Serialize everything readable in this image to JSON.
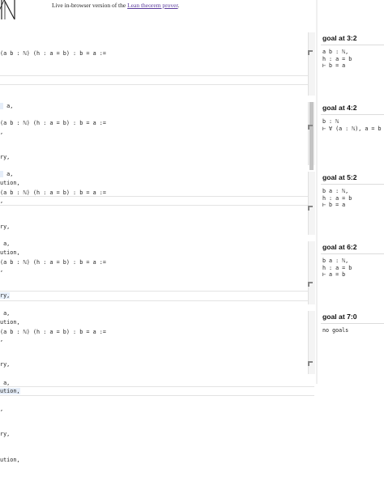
{
  "header": {
    "tagline_prefix": "Live in-browser version of the ",
    "tagline_link": "Lean theorem prover",
    "tagline_suffix": "."
  },
  "blocks": [
    {
      "lines": [
        "(a b : ℕ) (h : a = b) : b = a :=",
        "",
        " a,",
        ",",
        "ry,",
        "ution,"
      ],
      "goal": {
        "title": "goal at 3:2",
        "body": [
          "a b : ℕ,",
          "h : a = b",
          "⊢ b = a"
        ]
      }
    },
    {
      "lines": [
        "(a b : ℕ) (h : a = b) : b = a :=",
        "",
        " a,",
        ",",
        "ry,",
        "ution,"
      ],
      "goal": {
        "title": "goal at 4:2",
        "body": [
          "b : ℕ",
          "⊢ ∀ (a : ℕ), a = b"
        ]
      }
    },
    {
      "lines": [
        "(a b : ℕ) (h : a = b) : b = a :=",
        "",
        " a,",
        ",",
        "ry,",
        "ution,"
      ],
      "goal": {
        "title": "goal at 5:2",
        "body": [
          "b a : ℕ,",
          "h : a = b",
          "⊢ b = a"
        ]
      }
    },
    {
      "lines": [
        "(a b : ℕ) (h : a = b) : b = a :=",
        "",
        " a,",
        ",",
        "ry,",
        "ution,"
      ],
      "goal": {
        "title": "goal at 6:2",
        "body": [
          "b a : ℕ,",
          "h : a = b",
          "⊢ a = b"
        ]
      }
    },
    {
      "lines": [
        "(a b : ℕ) (h : a = b) : b = a :=",
        "",
        " a,",
        ",",
        "ry,",
        "ution,"
      ],
      "goal": {
        "title": "goal at 7:0",
        "body": [
          "no goals"
        ]
      }
    }
  ]
}
